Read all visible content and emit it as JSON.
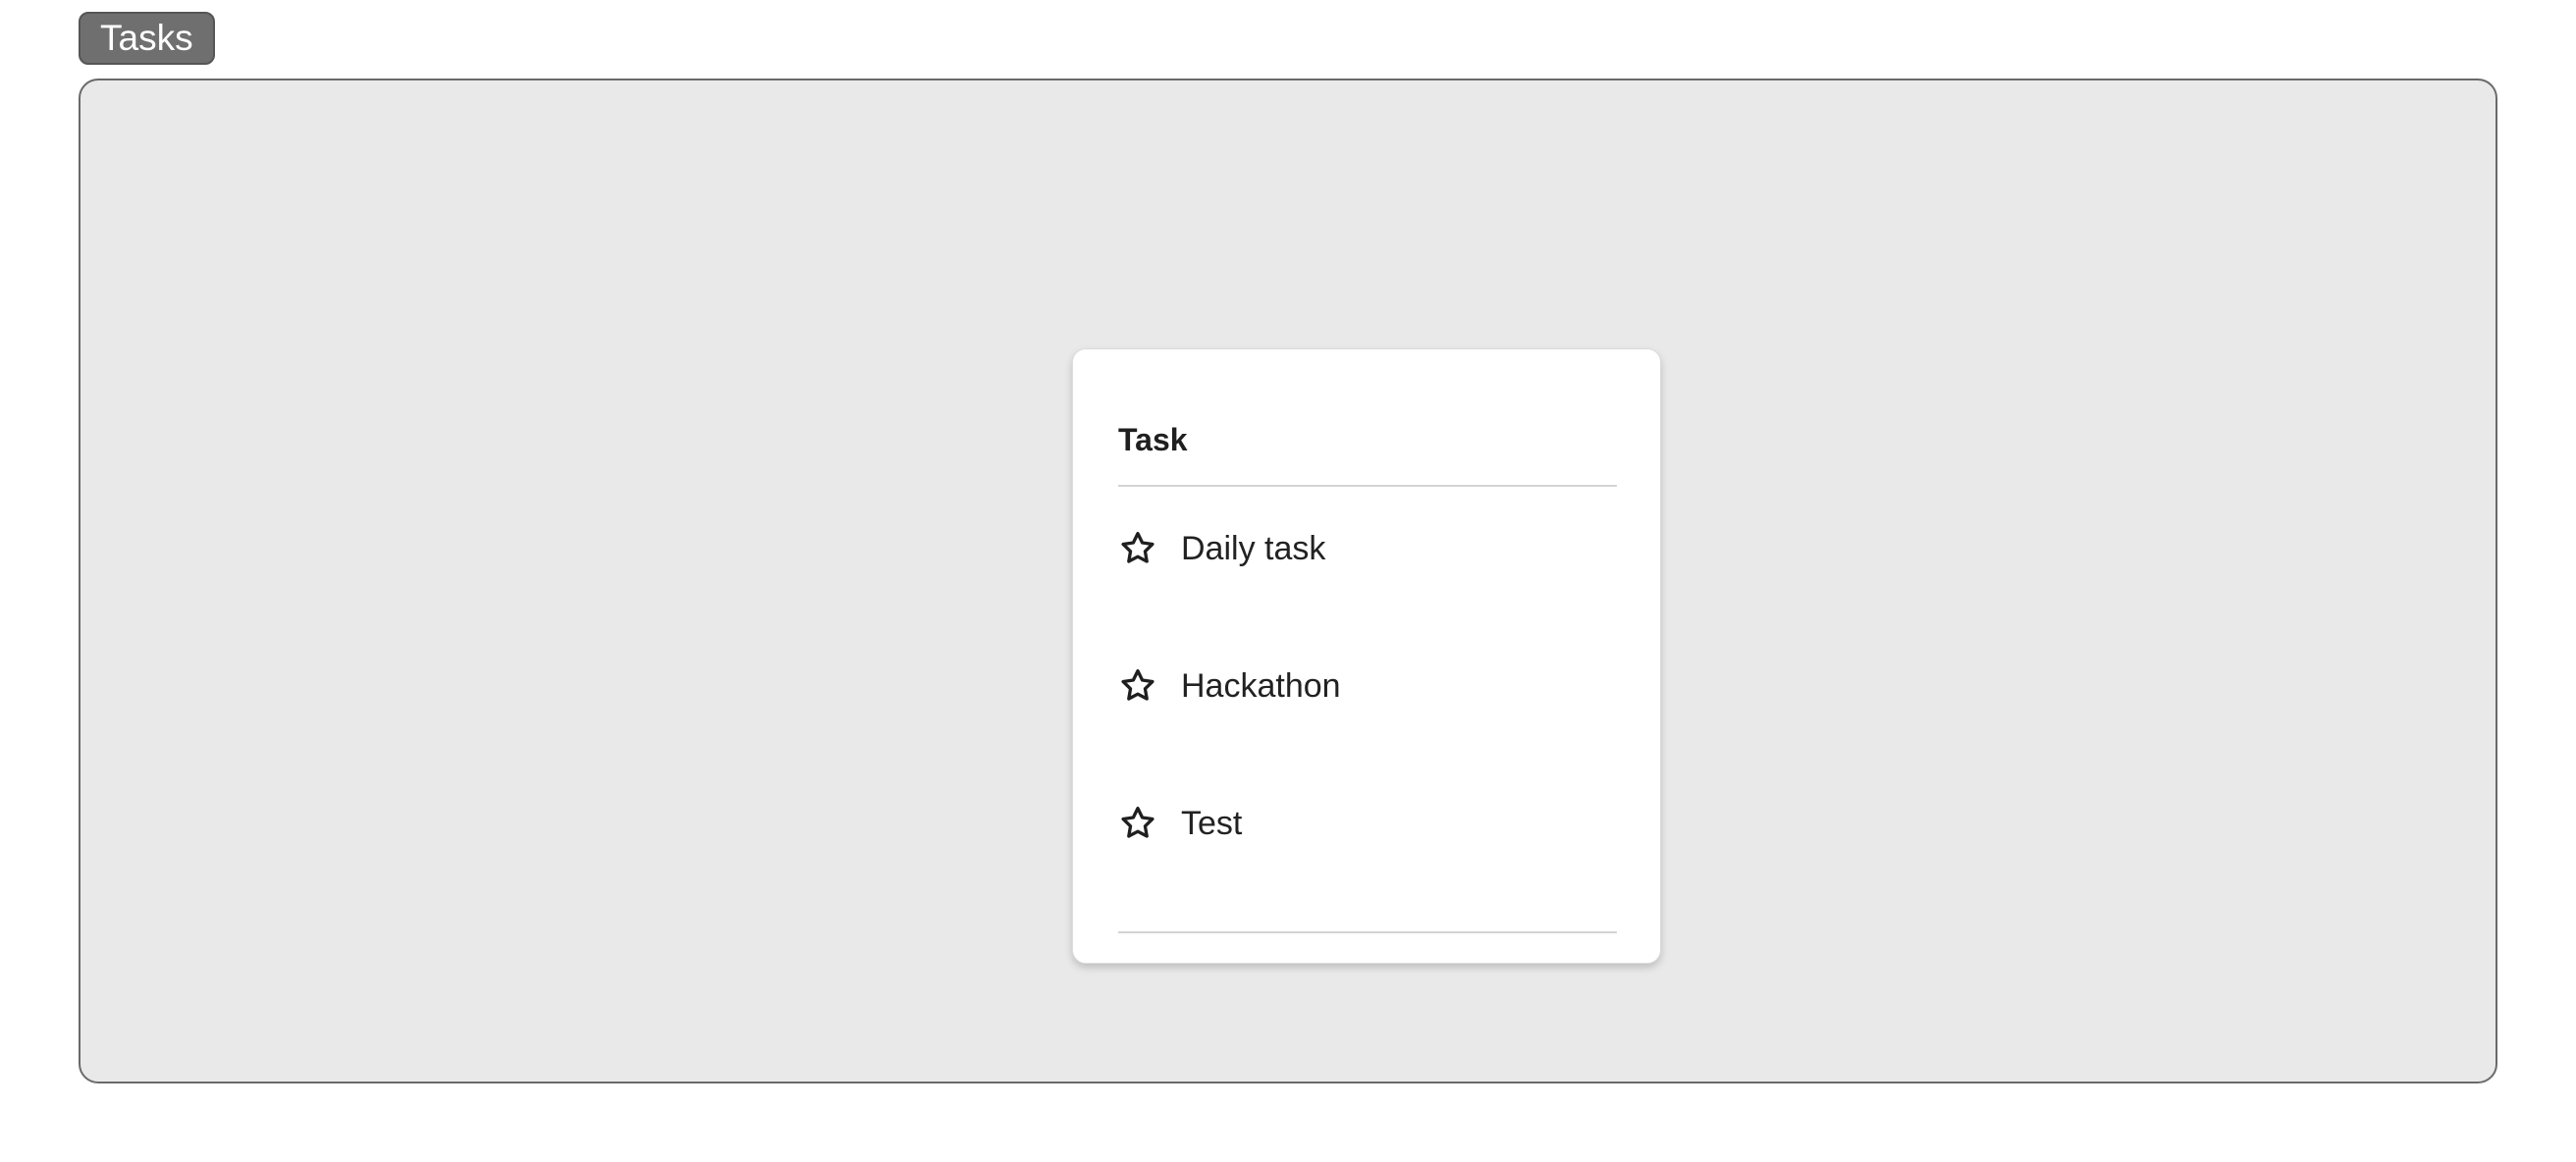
{
  "header": {
    "tab_label": "Tasks"
  },
  "card": {
    "title": "Task",
    "tasks": [
      {
        "label": "Daily task",
        "icon": "star-outline-icon"
      },
      {
        "label": "Hackathon",
        "icon": "star-outline-icon"
      },
      {
        "label": "Test",
        "icon": "star-outline-icon"
      }
    ]
  },
  "colors": {
    "tab_background": "#6f6f6f",
    "frame_background": "#e9e9e9",
    "card_background": "#ffffff",
    "text": "#222222"
  }
}
